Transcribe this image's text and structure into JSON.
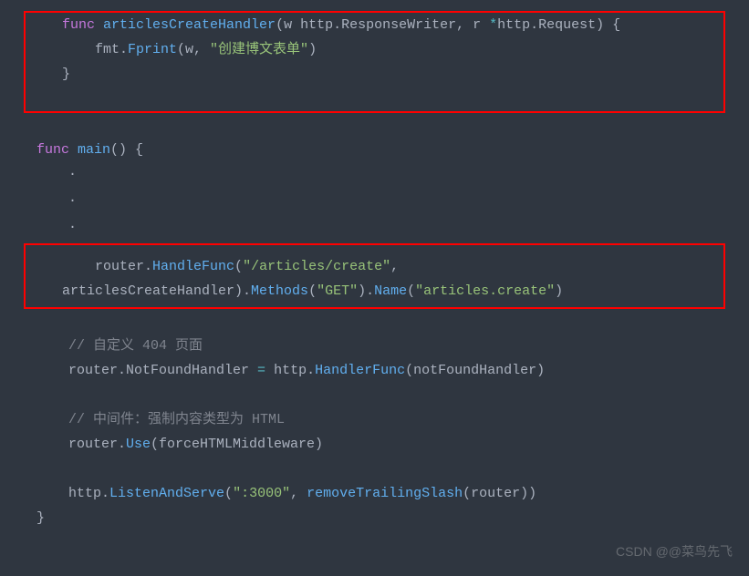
{
  "block1": {
    "line1": {
      "kw1": "func",
      "fn": "articlesCreateHandler",
      "params": "(w http.ResponseWriter, r ",
      "star": "*",
      "rest": "http.Request) {"
    },
    "line2": {
      "pre": "    fmt.",
      "fn": "Fprint",
      "args1": "(w, ",
      "str": "\"创建博文表单\"",
      "close": ")"
    },
    "line3": "}",
    "line4": " "
  },
  "mainfn": {
    "kw": "func",
    "name": "main",
    "sig": "() {",
    "dot": "."
  },
  "block2": {
    "line1": {
      "pre": "    router.",
      "fn": "HandleFunc",
      "open": "(",
      "str": "\"/articles/create\"",
      "comma": ","
    },
    "line2": {
      "pre": "articlesCreateHandler).",
      "fn1": "Methods",
      "open1": "(",
      "str1": "\"GET\"",
      "close1": ").",
      "fn2": "Name",
      "open2": "(",
      "str2": "\"articles.create\"",
      "close2": ")"
    }
  },
  "rest": {
    "comment1": "// 自定义 404 页面",
    "nf": {
      "pre": "router.NotFoundHandler ",
      "eq": "=",
      "mid": " http.",
      "fn": "HandlerFunc",
      "args": "(notFoundHandler)"
    },
    "comment2": "// 中间件：强制内容类型为 HTML",
    "use": {
      "pre": "router.",
      "fn": "Use",
      "args": "(forceHTMLMiddleware)"
    },
    "listen": {
      "pre": "http.",
      "fn": "ListenAndServe",
      "open": "(",
      "str": "\":3000\"",
      "mid": ", ",
      "fn2": "removeTrailingSlash",
      "args2": "(router))"
    },
    "close": "}"
  },
  "watermark": "CSDN @@菜鸟先飞"
}
